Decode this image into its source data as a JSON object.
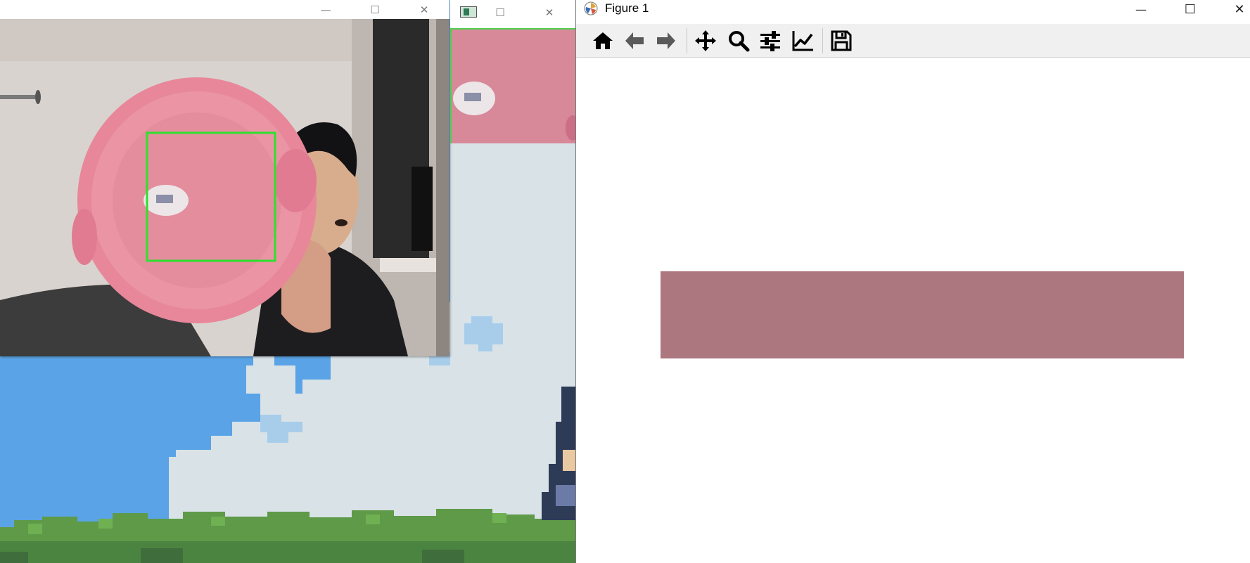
{
  "webcam_window": {
    "title": "",
    "buttons": {
      "minimize": "—",
      "maximize": "☐",
      "close": "✕"
    },
    "detection_box_color": "#2ee02e"
  },
  "crop_window": {
    "title": "",
    "buttons": {
      "maximize": "☐",
      "close": "✕"
    }
  },
  "figure_window": {
    "title": "Figure 1",
    "buttons": {
      "minimize": "—",
      "maximize": "☐",
      "close": "✕"
    },
    "toolbar": [
      {
        "name": "home-icon",
        "tooltip": "Home"
      },
      {
        "name": "back-icon",
        "tooltip": "Back"
      },
      {
        "name": "forward-icon",
        "tooltip": "Forward"
      },
      {
        "name": "pan-icon",
        "tooltip": "Pan"
      },
      {
        "name": "zoom-icon",
        "tooltip": "Zoom"
      },
      {
        "name": "subplots-icon",
        "tooltip": "Configure subplots"
      },
      {
        "name": "axes-edit-icon",
        "tooltip": "Edit axis"
      },
      {
        "name": "save-icon",
        "tooltip": "Save"
      }
    ],
    "swatch_color": "#ad7780"
  },
  "colors": {
    "sky": "#5aa3e6",
    "cloud": "#d8e2e7",
    "grass": "#5e9a48",
    "pink_object": "#e8879a"
  }
}
